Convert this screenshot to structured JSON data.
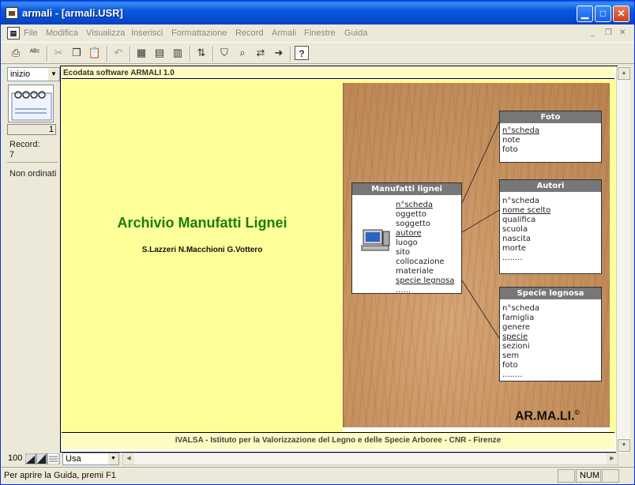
{
  "window": {
    "title": "armali - [armali.USR]"
  },
  "menu": {
    "items": [
      "File",
      "Modifica",
      "Visualizza",
      "Inserisci",
      "Formattazione",
      "Record",
      "Armali",
      "Finestre",
      "Guida"
    ],
    "mdi_min": "_",
    "mdi_restore": "❐",
    "mdi_close": "✕"
  },
  "toolbar": {
    "buttons": [
      "print-icon",
      "spellcheck-icon",
      "cut-icon",
      "copy-icon",
      "paste-icon",
      "undo-icon",
      "form-icon",
      "list-icon",
      "table-icon",
      "sort-icon",
      "filter-icon",
      "find-icon",
      "replace-icon",
      "goto-icon",
      "help-icon"
    ]
  },
  "left_panel": {
    "nav_value": "inizio",
    "record_number": "1",
    "record_label": "Record:",
    "record_count": "7",
    "sort_status": "Non ordinati"
  },
  "document": {
    "header": "Ecodata software ARMALI 1.0",
    "title": "Archivio Manufatti Lignei",
    "authors": "S.Lazzeri N.Macchioni G.Vottero",
    "footer": "IVALSA - Istituto per la Valorizzazione del Legno e delle Specie Arboree - CNR - Firenze",
    "logo_text": "AR.MA.LI.",
    "logo_mark": "©",
    "diagram": {
      "manufatti": {
        "title": "Manufatti lignei",
        "fields": [
          "n°scheda",
          "oggetto",
          "soggetto",
          "autore",
          "luogo",
          "sito",
          "collocazione",
          "materiale",
          "specie legnosa",
          "......"
        ],
        "keys": [
          0,
          3,
          8
        ]
      },
      "foto": {
        "title": "Foto",
        "fields": [
          "n°scheda",
          "note",
          "foto"
        ],
        "keys": [
          0
        ]
      },
      "autori": {
        "title": "Autori",
        "fields": [
          "n°scheda",
          "nome scelto",
          "qualifica",
          "scuola",
          "nascita",
          "morte",
          "........"
        ],
        "keys": [
          1
        ]
      },
      "specie": {
        "title": "Specie legnosa",
        "fields": [
          "n°scheda",
          "famiglia",
          "genere",
          "specie",
          "sezioni",
          "sem",
          "foto",
          "........"
        ],
        "keys": [
          3
        ]
      }
    }
  },
  "bottom": {
    "zoom": "100",
    "language": "Usa"
  },
  "status": {
    "text": "Per aprire la Guida, premi F1",
    "num": "NUM"
  }
}
